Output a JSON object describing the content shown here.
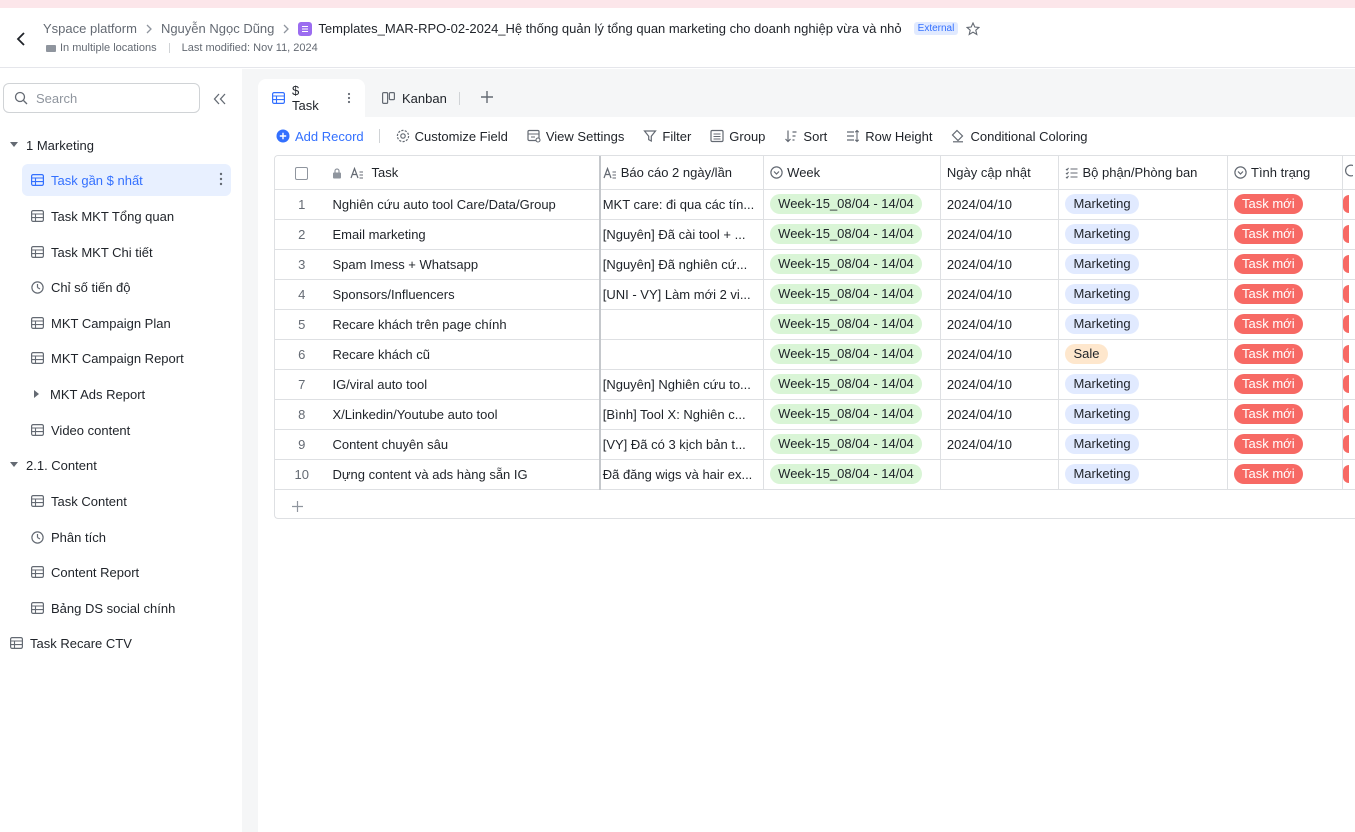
{
  "header": {
    "breadcrumbs": [
      "Yspace platform",
      "Nguyễn Ngọc Dũng"
    ],
    "doc_title": "Templates_MAR-RPO-02-2024_Hệ thống quản lý tổng quan marketing cho doanh nghiệp vừa và nhỏ",
    "badge": "External",
    "location": "In multiple locations",
    "last_modified": "Last modified: Nov 11, 2024"
  },
  "sidebar": {
    "search_placeholder": "Search",
    "items": [
      {
        "label": "1 Marketing"
      },
      {
        "label": "Task gần $ nhất"
      },
      {
        "label": "Task MKT Tổng quan"
      },
      {
        "label": "Task MKT Chi tiết"
      },
      {
        "label": "Chỉ số tiến độ"
      },
      {
        "label": "MKT Campaign Plan"
      },
      {
        "label": "MKT Campaign Report"
      },
      {
        "label": "MKT Ads Report"
      },
      {
        "label": "Video content"
      },
      {
        "label": "2.1. Content"
      },
      {
        "label": "Task Content"
      },
      {
        "label": "Phân tích"
      },
      {
        "label": "Content Report"
      },
      {
        "label": "Bảng DS social chính"
      },
      {
        "label": "Task Recare CTV"
      }
    ]
  },
  "tabs": [
    {
      "label": "$ Task"
    },
    {
      "label": "Kanban"
    }
  ],
  "toolbar": {
    "add_record": "Add Record",
    "customize_field": "Customize Field",
    "view_settings": "View Settings",
    "filter": "Filter",
    "group": "Group",
    "sort": "Sort",
    "row_height": "Row Height",
    "conditional_coloring": "Conditional Coloring"
  },
  "table": {
    "columns": {
      "task": "Task",
      "report": "Báo cáo 2 ngày/lần",
      "week": "Week",
      "updated": "Ngày cập nhật",
      "dept": "Bộ phận/Phòng ban",
      "status": "Tình trạng"
    },
    "rows": [
      {
        "num": "1",
        "task": "Nghiên cứu auto tool Care/Data/Group",
        "report": "MKT care: đi qua các tín...",
        "week": "Week-15_08/04 - 14/04",
        "updated": "2024/04/10",
        "dept": "Marketing",
        "status": "Task mới"
      },
      {
        "num": "2",
        "task": "Email marketing",
        "report": "[Nguyên] Đã cài tool + ...",
        "week": "Week-15_08/04 - 14/04",
        "updated": "2024/04/10",
        "dept": "Marketing",
        "status": "Task mới"
      },
      {
        "num": "3",
        "task": "Spam Imess + Whatsapp",
        "report": "[Nguyên] Đã nghiên cứ...",
        "week": "Week-15_08/04 - 14/04",
        "updated": "2024/04/10",
        "dept": "Marketing",
        "status": "Task mới"
      },
      {
        "num": "4",
        "task": "Sponsors/Influencers",
        "report": "[UNI - VY] Làm mới 2 vi...",
        "week": "Week-15_08/04 - 14/04",
        "updated": "2024/04/10",
        "dept": "Marketing",
        "status": "Task mới"
      },
      {
        "num": "5",
        "task": "Recare khách trên page chính",
        "report": "",
        "week": "Week-15_08/04 - 14/04",
        "updated": "2024/04/10",
        "dept": "Marketing",
        "status": "Task mới"
      },
      {
        "num": "6",
        "task": "Recare khách cũ",
        "report": "",
        "week": "Week-15_08/04 - 14/04",
        "updated": "2024/04/10",
        "dept": "Sale",
        "status": "Task mới"
      },
      {
        "num": "7",
        "task": "IG/viral auto tool",
        "report": "[Nguyên] Nghiên cứu to...",
        "week": "Week-15_08/04 - 14/04",
        "updated": "2024/04/10",
        "dept": "Marketing",
        "status": "Task mới"
      },
      {
        "num": "8",
        "task": "X/Linkedin/Youtube auto tool",
        "report": "[Bình] Tool X: Nghiên c...",
        "week": "Week-15_08/04 - 14/04",
        "updated": "2024/04/10",
        "dept": "Marketing",
        "status": "Task mới"
      },
      {
        "num": "9",
        "task": "Content chuyên sâu",
        "report": "[VY] Đã có 3 kịch bản t...",
        "week": "Week-15_08/04 - 14/04",
        "updated": "2024/04/10",
        "dept": "Marketing",
        "status": "Task mới"
      },
      {
        "num": "10",
        "task": "Dựng content và ads hàng sẵn IG",
        "report": "Đã đăng wigs và hair ex...",
        "week": "Week-15_08/04 - 14/04",
        "updated": "",
        "dept": "Marketing",
        "status": "Task mới"
      }
    ]
  },
  "colors": {
    "accent": "#3370ff",
    "status_red": "#f76964",
    "week_green": "#d9f5d6",
    "dept_blue": "#e1eaff",
    "sale_orange": "#fee7cd"
  }
}
